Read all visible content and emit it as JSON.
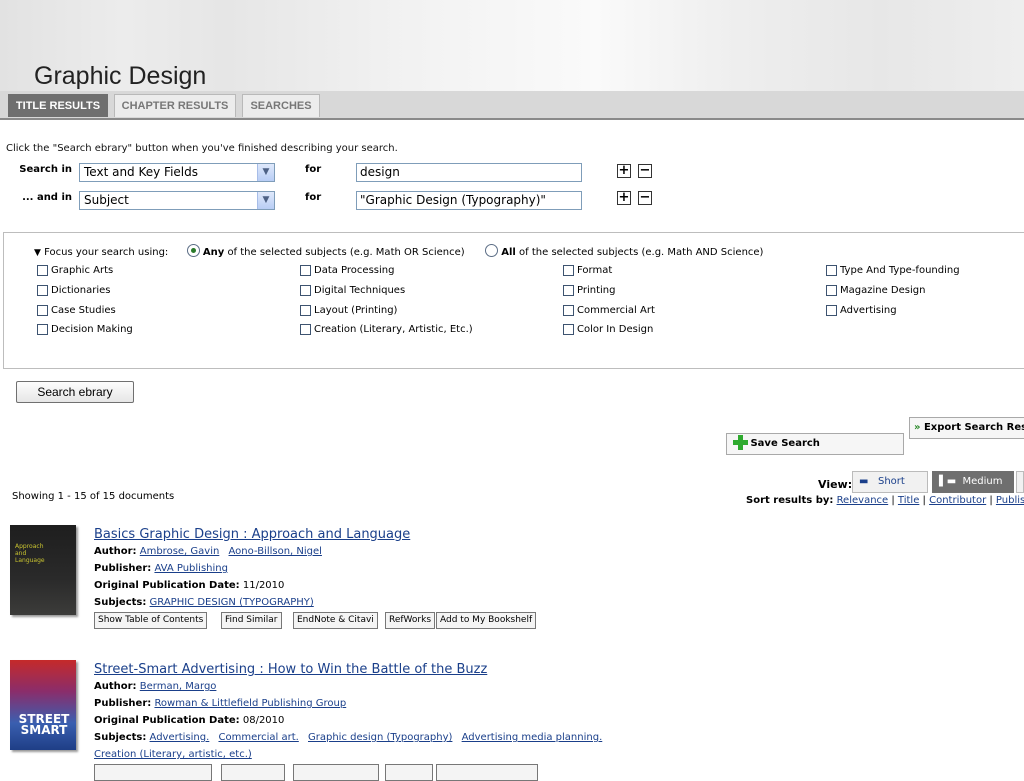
{
  "header": {
    "title": "Graphic Design"
  },
  "tabs": [
    {
      "label": "TITLE RESULTS",
      "active": true
    },
    {
      "label": "CHAPTER RESULTS",
      "active": false
    },
    {
      "label": "SEARCHES",
      "active": false
    }
  ],
  "search": {
    "hint": "Click the \"Search ebrary\" button when you've finished describing your search.",
    "rows": [
      {
        "label": "Search in",
        "field": "Text and Key Fields",
        "for_label": "for",
        "value": "design"
      },
      {
        "label": "... and in",
        "field": "Subject",
        "for_label": "for",
        "value": "\"Graphic Design (Typography)\""
      }
    ],
    "button_label": "Search ebrary"
  },
  "focus": {
    "label": "Focus your search using:",
    "any_bold": "Any",
    "any_rest": "of the selected subjects (e.g. Math OR Science)",
    "all_bold": "All",
    "all_rest": "of the selected subjects (e.g. Math AND Science)",
    "selected": "any",
    "columns": [
      [
        "Graphic Arts",
        "Dictionaries",
        "Case Studies",
        "Decision Making"
      ],
      [
        "Data Processing",
        "Digital Techniques",
        "Layout (Printing)",
        "Creation (Literary, Artistic, Etc.)"
      ],
      [
        "Format",
        "Printing",
        "Commercial Art",
        "Color In Design"
      ],
      [
        "Type And Type-founding",
        "Magazine Design",
        "Advertising"
      ]
    ]
  },
  "tools": {
    "export_label": "Export Search Resu",
    "save_label": "Save Search"
  },
  "results_meta": {
    "showing": "Showing 1 - 15 of 15 documents",
    "view_label": "View:",
    "views": [
      "Short",
      "Medium"
    ],
    "sort_label": "Sort results by:",
    "sort_options": [
      "Relevance",
      "Title",
      "Contributor",
      "Publis"
    ]
  },
  "labels": {
    "author": "Author:",
    "publisher": "Publisher:",
    "pubdate": "Original Publication Date:",
    "subjects": "Subjects:"
  },
  "results": [
    {
      "title": "Basics Graphic Design : Approach and Language",
      "authors": [
        "Ambrose, Gavin",
        "Aono-Billson, Nigel"
      ],
      "publisher": "AVA Publishing",
      "pubdate": "11/2010",
      "subjects": [
        "GRAPHIC DESIGN (TYPOGRAPHY)"
      ],
      "thumb_text": "Approach and Language",
      "buttons": [
        "Show Table of Contents",
        "Find Similar",
        "EndNote & Citavi",
        "RefWorks",
        "Add to My Bookshelf"
      ]
    },
    {
      "title": "Street-Smart Advertising : How to Win the Battle of the Buzz",
      "authors": [
        "Berman, Margo"
      ],
      "publisher": "Rowman & Littlefield Publishing Group",
      "pubdate": "08/2010",
      "subjects": [
        "Advertising.",
        "Commercial art.",
        "Graphic design (Typography)",
        "Advertising media planning."
      ],
      "subjects_cont": "Creation (Literary, artistic, etc.)",
      "thumb_text": "STREET SMART"
    }
  ],
  "colors": {
    "link": "#1a3f8a",
    "active_tab": "#6f6f6f",
    "save_plus": "#2eaa2e"
  }
}
